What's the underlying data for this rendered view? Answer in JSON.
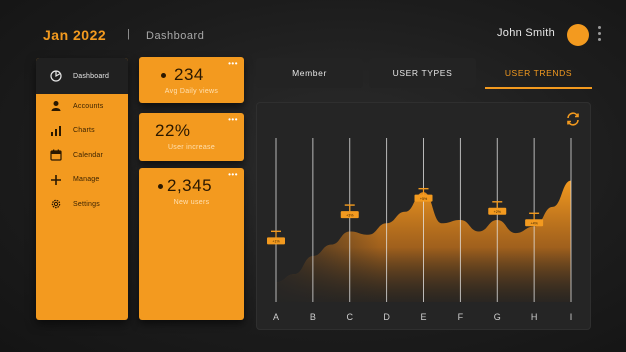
{
  "header": {
    "date": "Jan 2022",
    "separator": "|",
    "title": "Dashboard",
    "user_name": "John Smith"
  },
  "sidebar": {
    "items": [
      {
        "label": "Dashboard",
        "icon": "dashboard-icon",
        "active": true
      },
      {
        "label": "Accounts",
        "icon": "user-icon",
        "active": false
      },
      {
        "label": "Charts",
        "icon": "chart-icon",
        "active": false
      },
      {
        "label": "Calendar",
        "icon": "calendar-icon",
        "active": false
      },
      {
        "label": "Manage",
        "icon": "plus-icon",
        "active": false
      },
      {
        "label": "Settings",
        "icon": "gear-icon",
        "active": false
      }
    ]
  },
  "stats": [
    {
      "value": "234",
      "caption": "Avg Daily views",
      "menu": "•••"
    },
    {
      "value": "22%",
      "caption": "User increase",
      "menu": "•••"
    },
    {
      "value": "2,345",
      "caption": "New users",
      "menu": "•••"
    }
  ],
  "tabs": [
    {
      "label": "Member",
      "active": false
    },
    {
      "label": "USER TYPES",
      "active": false
    },
    {
      "label": "USER TRENDS",
      "active": true
    }
  ],
  "colors": {
    "accent": "#f39a1f",
    "card_text": "#2a1800",
    "panel": "#252525"
  },
  "chart_data": {
    "type": "area",
    "categories": [
      "A",
      "B",
      "C",
      "D",
      "E",
      "F",
      "G",
      "H",
      "I"
    ],
    "curve_x": [
      0,
      0.5,
      1,
      1.5,
      2,
      2.5,
      3,
      3.5,
      4,
      4.5,
      5,
      5.5,
      6,
      6.5,
      7,
      7.5,
      8
    ],
    "curve_y": [
      0.12,
      0.17,
      0.28,
      0.35,
      0.43,
      0.41,
      0.48,
      0.55,
      0.67,
      0.48,
      0.5,
      0.43,
      0.5,
      0.42,
      0.46,
      0.58,
      0.74
    ],
    "markers": [
      {
        "x": 0,
        "y": 0.37,
        "label": "+1%"
      },
      {
        "x": 2,
        "y": 0.53,
        "label": "+3%"
      },
      {
        "x": 4,
        "y": 0.63,
        "label": "+5%"
      },
      {
        "x": 6,
        "y": 0.55,
        "label": "+2%"
      },
      {
        "x": 7,
        "y": 0.48,
        "label": "+4%"
      }
    ],
    "ylim": [
      0,
      1
    ],
    "grid": true
  }
}
